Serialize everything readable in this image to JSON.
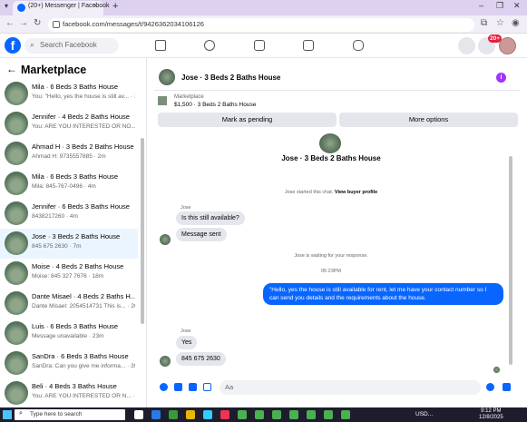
{
  "browser": {
    "tab_title": "(20+) Messenger | Facebook",
    "url": "facebook.com/messages/t/9426362034106126"
  },
  "header": {
    "logo_letter": "f",
    "search_placeholder": "Search Facebook",
    "notification_count": "20+"
  },
  "sidebar": {
    "title": "Marketplace",
    "items": [
      {
        "name": "Mila · 6 Beds 3 Baths House",
        "snippet": "You: \"Hello, yes the house is still av... · 1m",
        "selected": false
      },
      {
        "name": "Jennifer · 4 Beds 2 Baths House",
        "snippet": "You: ARE YOU INTERESTED OR NO... · 1m",
        "selected": false
      },
      {
        "name": "Ahmad H · 3 Beds 2 Baths House",
        "snippet": "Ahmad H: 9735557885 · 2m",
        "selected": false
      },
      {
        "name": "Mila · 6 Beds 3 Baths House",
        "snippet": "Mila: 845-767-0496 · 4m",
        "selected": false
      },
      {
        "name": "Jennifer · 6 Beds 3 Baths House",
        "snippet": "8438217260 · 4m",
        "selected": false
      },
      {
        "name": "Jose · 3 Beds 2 Baths House",
        "snippet": "845 675 2630 · 7m",
        "selected": true
      },
      {
        "name": "Moise · 4 Beds 2 Baths House",
        "snippet": "Moise: 845 327 7676 · 18m",
        "selected": false
      },
      {
        "name": "Dante Misael · 4 Beds 2 Baths H...",
        "snippet": "Dante Misael: 2054514731 This is... · 20m",
        "selected": false
      },
      {
        "name": "Luis · 6 Beds 3 Baths House",
        "snippet": "Message unavailable · 23m",
        "selected": false
      },
      {
        "name": "SanDra · 6 Beds 3 Baths House",
        "snippet": "SanDra: Can you give me informa... · 39m",
        "selected": false
      },
      {
        "name": "Beli · 4 Beds 3 Baths House",
        "snippet": "You: ARE YOU INTERESTED OR N... · 55m",
        "selected": false
      }
    ]
  },
  "chat": {
    "title": "Jose · 3 Beds 2 Baths House",
    "listing_label": "Marketplace",
    "listing_detail": "$1,500 · 3 Beds 2 Baths House",
    "pending_button": "Mark as pending",
    "more_button": "More options",
    "conversation_name": "Jose · 3 Beds 2 Baths House",
    "started_text": "Jose started this chat.",
    "view_profile": "View buyer profile",
    "sender": "Jose",
    "msg1": "Is this still available?",
    "msg2": "Message sent",
    "waiting_text": "Jose is waiting for your response.",
    "time": "05:23PM",
    "outgoing": "\"Hello, yes the house is still available for rent, let me have your contact number so I can send you details and the requirements about the house.",
    "sender2": "Jose",
    "msg3": "Yes",
    "msg4": "845 675 2630",
    "composer_placeholder": "Aa"
  },
  "taskbar": {
    "search_placeholder": "Type here to search",
    "weather": "USD...",
    "time": "9:12 PM",
    "date": "12/8/2025"
  }
}
